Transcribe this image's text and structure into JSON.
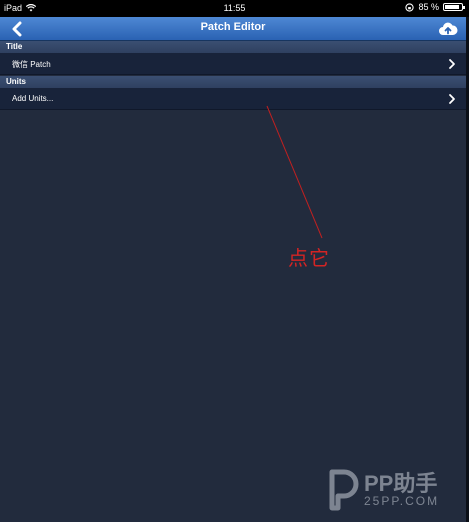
{
  "status_bar": {
    "device": "iPad",
    "time": "11:55",
    "battery": "85 %",
    "battery_level": 0.85
  },
  "nav": {
    "title": "Patch Editor",
    "back_icon": "chevron-left-icon",
    "upload_icon": "cloud-upload-icon"
  },
  "sections": [
    {
      "header": "Title",
      "rows": [
        {
          "label": "微信 Patch"
        }
      ]
    },
    {
      "header": "Units",
      "rows": [
        {
          "label": "Add Units..."
        }
      ]
    }
  ],
  "annotation": {
    "text": "点它",
    "color": "#d32424"
  },
  "watermark": {
    "brand": "PP助手",
    "domain": "25PP.COM"
  }
}
